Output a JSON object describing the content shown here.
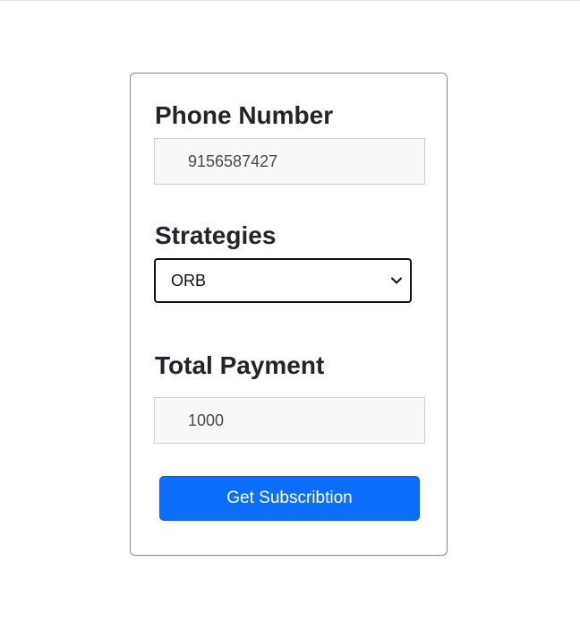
{
  "form": {
    "phone": {
      "label": "Phone Number",
      "value": "9156587427"
    },
    "strategies": {
      "label": "Strategies",
      "selected": "ORB"
    },
    "payment": {
      "label": "Total Payment",
      "value": "1000"
    },
    "submit_label": "Get Subscribtion"
  },
  "colors": {
    "primary_button": "#0d6efd",
    "field_background": "#f8f8f8",
    "heading_text": "#212529"
  },
  "icons": {
    "select_indicator": "chevron-down-icon"
  }
}
